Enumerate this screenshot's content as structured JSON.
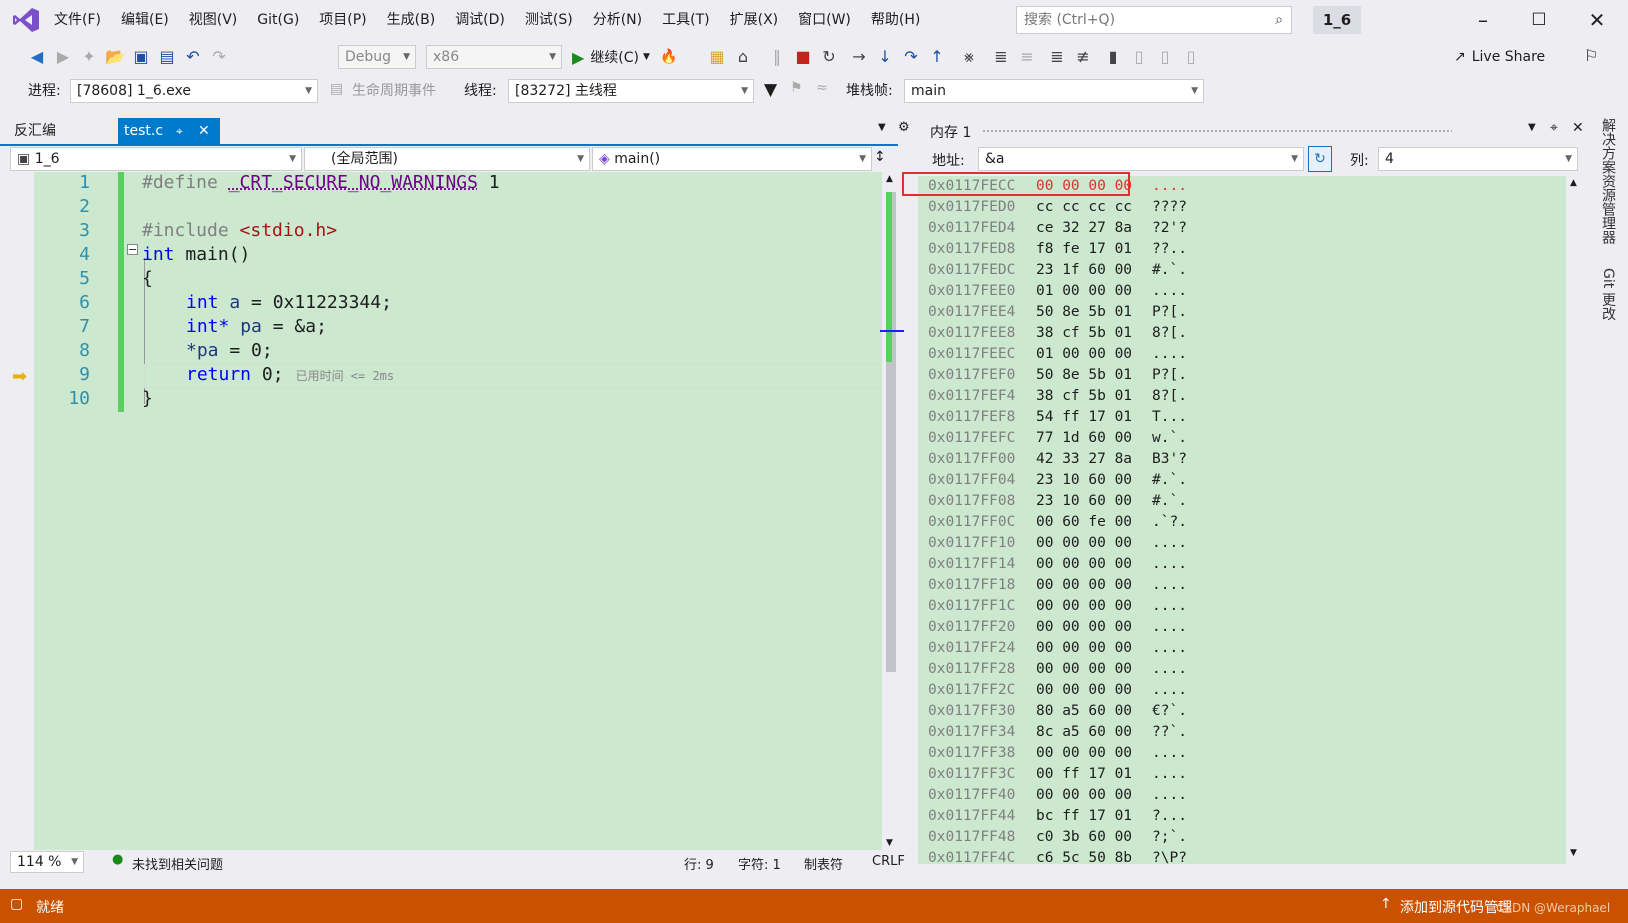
{
  "menu": [
    "文件(F)",
    "编辑(E)",
    "视图(V)",
    "Git(G)",
    "项目(P)",
    "生成(B)",
    "调试(D)",
    "测试(S)",
    "分析(N)",
    "工具(T)",
    "扩展(X)",
    "窗口(W)",
    "帮助(H)"
  ],
  "search": {
    "placeholder": "搜索 (Ctrl+Q)"
  },
  "solution_name": "1_6",
  "toolbar": {
    "config": "Debug",
    "platform": "x86",
    "continue": "继续(C)",
    "live_share": "Live Share"
  },
  "debugbar": {
    "process_label": "进程:",
    "process_value": "[78608] 1_6.exe",
    "lifecycle_label": "生命周期事件",
    "thread_label": "线程:",
    "thread_value": "[83272] 主线程",
    "stackframe_label": "堆栈帧:",
    "stackframe_value": "main"
  },
  "tabs": {
    "disasm": "反汇编",
    "testc": "test.c"
  },
  "nav": {
    "project": "1_6",
    "scope": "(全局范围)",
    "func": "main()"
  },
  "code": {
    "line_numbers": [
      "1",
      "2",
      "3",
      "4",
      "5",
      "6",
      "7",
      "8",
      "9",
      "10"
    ],
    "l1_kw": "#define",
    "l1_macro": "_CRT_SECURE_NO_WARNINGS",
    "l1_val": "1",
    "l3_kw": "#include",
    "l3_str": "<stdio.h>",
    "l4_kw": "int",
    "l4_rest": "main()",
    "l5": "{",
    "l6_kw": "int",
    "l6_var": "a",
    "l6_rest": "= 0x11223344;",
    "l7_kw": "int*",
    "l7_var": "pa",
    "l7_rest": "= &a;",
    "l8_var": "*pa",
    "l8_rest": "= 0;",
    "l9_kw": "return",
    "l9_rest": "0;",
    "l9_tip": "已用时间 <= 2ms",
    "l10": "}"
  },
  "editor_status": {
    "zoom": "114 %",
    "issues": "未找到相关问题",
    "line": "行: 9",
    "char": "字符: 1",
    "tabs": "制表符",
    "eol": "CRLF"
  },
  "memory": {
    "title": "内存 1",
    "address_label": "地址:",
    "address_value": "&a",
    "columns_label": "列:",
    "columns_value": "4",
    "rows": [
      {
        "addr": "0x0117FECC",
        "bytes": "00 00 00 00",
        "text": "...."
      },
      {
        "addr": "0x0117FED0",
        "bytes": "cc cc cc cc",
        "text": "????"
      },
      {
        "addr": "0x0117FED4",
        "bytes": "ce 32 27 8a",
        "text": "?2'?"
      },
      {
        "addr": "0x0117FED8",
        "bytes": "f8 fe 17 01",
        "text": "??.."
      },
      {
        "addr": "0x0117FEDC",
        "bytes": "23 1f 60 00",
        "text": "#.`."
      },
      {
        "addr": "0x0117FEE0",
        "bytes": "01 00 00 00",
        "text": "...."
      },
      {
        "addr": "0x0117FEE4",
        "bytes": "50 8e 5b 01",
        "text": "P?[."
      },
      {
        "addr": "0x0117FEE8",
        "bytes": "38 cf 5b 01",
        "text": "8?[."
      },
      {
        "addr": "0x0117FEEC",
        "bytes": "01 00 00 00",
        "text": "...."
      },
      {
        "addr": "0x0117FEF0",
        "bytes": "50 8e 5b 01",
        "text": "P?[."
      },
      {
        "addr": "0x0117FEF4",
        "bytes": "38 cf 5b 01",
        "text": "8?[."
      },
      {
        "addr": "0x0117FEF8",
        "bytes": "54 ff 17 01",
        "text": "T..."
      },
      {
        "addr": "0x0117FEFC",
        "bytes": "77 1d 60 00",
        "text": "w.`."
      },
      {
        "addr": "0x0117FF00",
        "bytes": "42 33 27 8a",
        "text": "B3'?"
      },
      {
        "addr": "0x0117FF04",
        "bytes": "23 10 60 00",
        "text": "#.`."
      },
      {
        "addr": "0x0117FF08",
        "bytes": "23 10 60 00",
        "text": "#.`."
      },
      {
        "addr": "0x0117FF0C",
        "bytes": "00 60 fe 00",
        "text": ".`?."
      },
      {
        "addr": "0x0117FF10",
        "bytes": "00 00 00 00",
        "text": "...."
      },
      {
        "addr": "0x0117FF14",
        "bytes": "00 00 00 00",
        "text": "...."
      },
      {
        "addr": "0x0117FF18",
        "bytes": "00 00 00 00",
        "text": "...."
      },
      {
        "addr": "0x0117FF1C",
        "bytes": "00 00 00 00",
        "text": "...."
      },
      {
        "addr": "0x0117FF20",
        "bytes": "00 00 00 00",
        "text": "...."
      },
      {
        "addr": "0x0117FF24",
        "bytes": "00 00 00 00",
        "text": "...."
      },
      {
        "addr": "0x0117FF28",
        "bytes": "00 00 00 00",
        "text": "...."
      },
      {
        "addr": "0x0117FF2C",
        "bytes": "00 00 00 00",
        "text": "...."
      },
      {
        "addr": "0x0117FF30",
        "bytes": "80 a5 60 00",
        "text": "€?`."
      },
      {
        "addr": "0x0117FF34",
        "bytes": "8c a5 60 00",
        "text": "??`."
      },
      {
        "addr": "0x0117FF38",
        "bytes": "00 00 00 00",
        "text": "...."
      },
      {
        "addr": "0x0117FF3C",
        "bytes": "00 ff 17 01",
        "text": "...."
      },
      {
        "addr": "0x0117FF40",
        "bytes": "00 00 00 00",
        "text": "...."
      },
      {
        "addr": "0x0117FF44",
        "bytes": "bc ff 17 01",
        "text": "?..."
      },
      {
        "addr": "0x0117FF48",
        "bytes": "c0 3b 60 00",
        "text": "?;`."
      },
      {
        "addr": "0x0117FF4C",
        "bytes": "c6 5c 50 8b",
        "text": "?\\P?"
      }
    ]
  },
  "side_tabs": [
    "解决方案资源管理器",
    "Git 更改"
  ],
  "statusbar": {
    "ready": "就绪",
    "add_source": "添加到源代码管理",
    "watermark": "CSDN @Weraphael"
  },
  "colors": {
    "accent": "#007acc",
    "status": "#ca5100",
    "editor_bg": "#cce8cf",
    "highlight_box": "#e03030"
  }
}
